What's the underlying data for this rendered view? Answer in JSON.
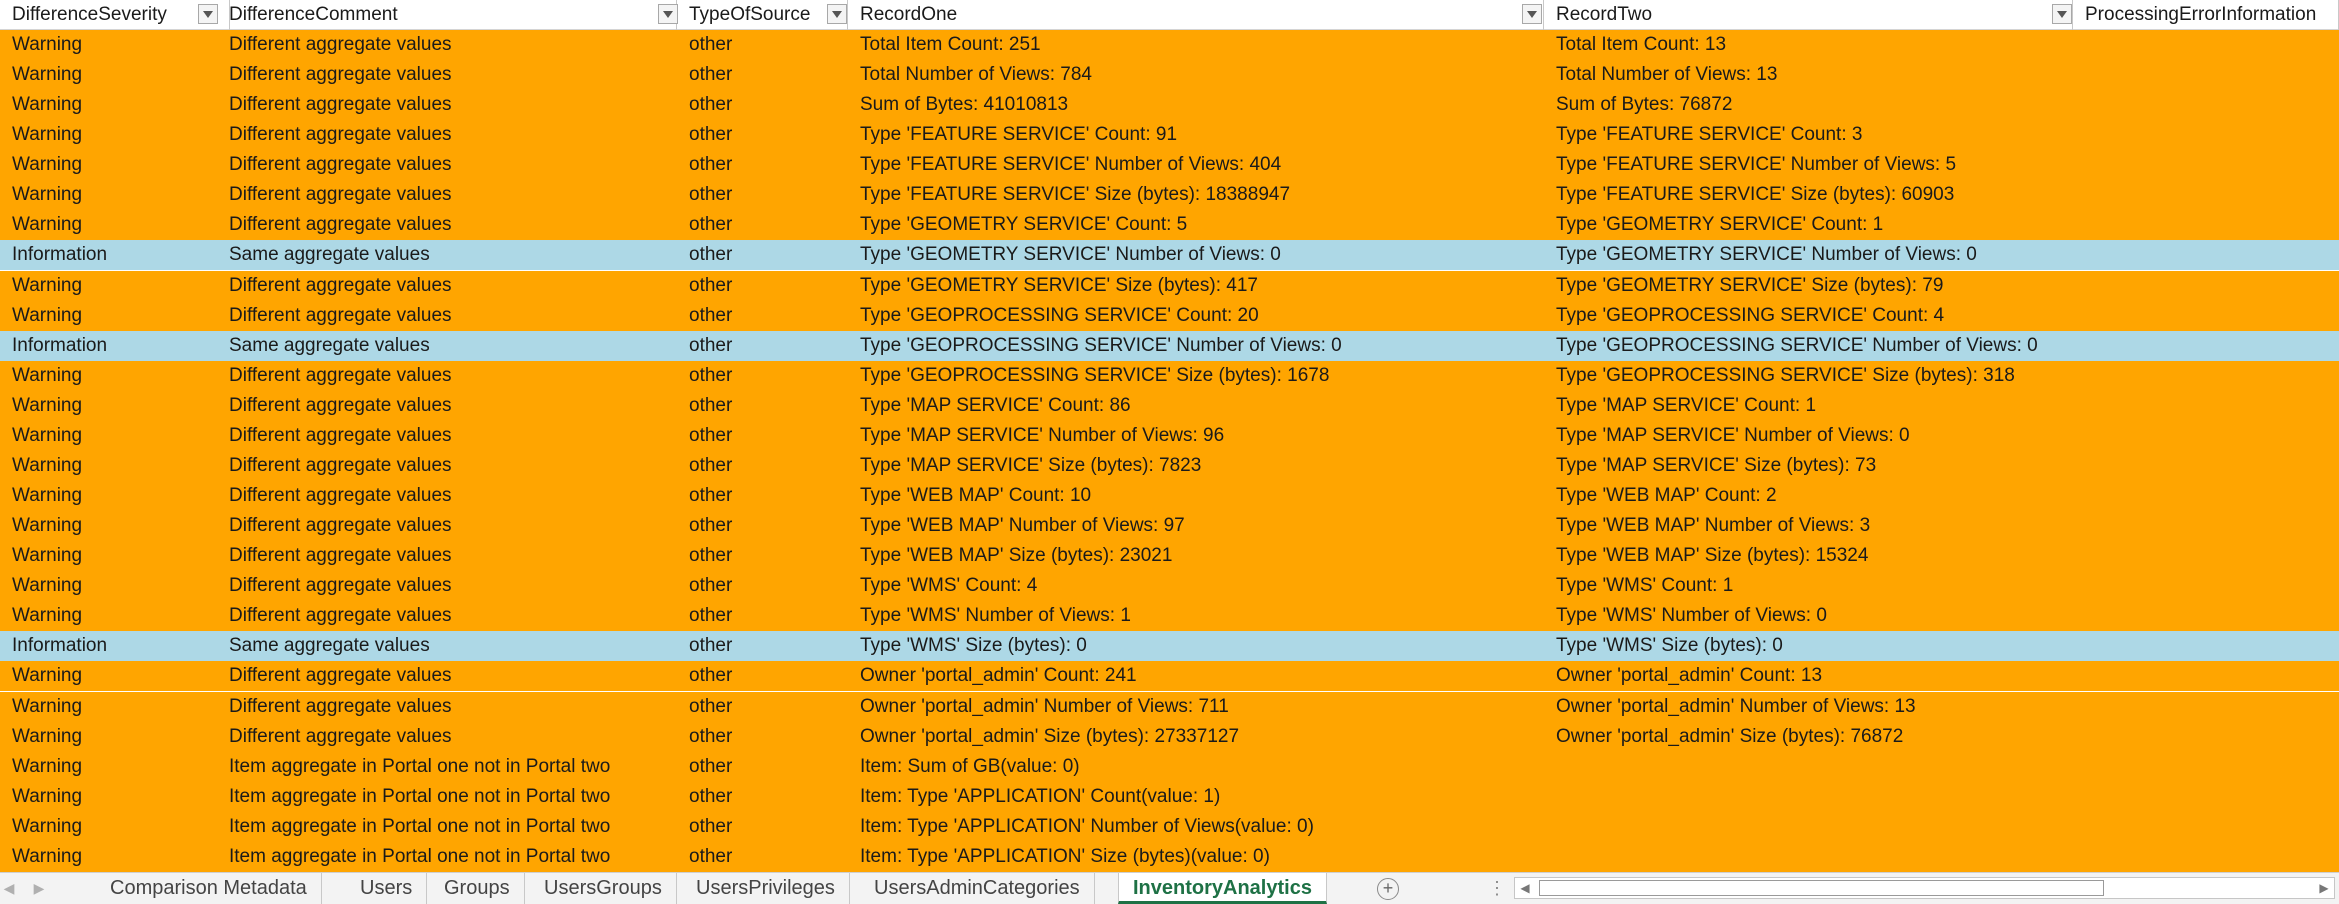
{
  "colors": {
    "warning_row": "#ffa500",
    "information_row": "#add8e6",
    "active_tab_text": "#1e7145"
  },
  "columns": [
    "DifferenceSeverity",
    "DifferenceComment",
    "TypeOfSource",
    "RecordOne",
    "RecordTwo",
    "ProcessingErrorInformation"
  ],
  "rows": [
    {
      "severity": "Warning",
      "comment": "Different aggregate values",
      "source": "other",
      "record_one": "Total Item Count: 251",
      "record_two": "Total Item Count: 13"
    },
    {
      "severity": "Warning",
      "comment": "Different aggregate values",
      "source": "other",
      "record_one": "Total Number of Views: 784",
      "record_two": "Total Number of Views: 13"
    },
    {
      "severity": "Warning",
      "comment": "Different aggregate values",
      "source": "other",
      "record_one": "Sum of Bytes: 41010813",
      "record_two": "Sum of Bytes: 76872"
    },
    {
      "severity": "Warning",
      "comment": "Different aggregate values",
      "source": "other",
      "record_one": "Type 'FEATURE SERVICE' Count: 91",
      "record_two": "Type 'FEATURE SERVICE' Count: 3"
    },
    {
      "severity": "Warning",
      "comment": "Different aggregate values",
      "source": "other",
      "record_one": "Type 'FEATURE SERVICE' Number of Views: 404",
      "record_two": "Type 'FEATURE SERVICE' Number of Views: 5"
    },
    {
      "severity": "Warning",
      "comment": "Different aggregate values",
      "source": "other",
      "record_one": "Type 'FEATURE SERVICE' Size (bytes): 18388947",
      "record_two": "Type 'FEATURE SERVICE' Size (bytes): 60903"
    },
    {
      "severity": "Warning",
      "comment": "Different aggregate values",
      "source": "other",
      "record_one": "Type 'GEOMETRY SERVICE' Count: 5",
      "record_two": "Type 'GEOMETRY SERVICE' Count: 1"
    },
    {
      "severity": "Information",
      "comment": "Same aggregate values",
      "source": "other",
      "record_one": "Type 'GEOMETRY SERVICE' Number of Views: 0",
      "record_two": "Type 'GEOMETRY SERVICE' Number of Views: 0"
    },
    {
      "severity": "Warning",
      "comment": "Different aggregate values",
      "source": "other",
      "record_one": "Type 'GEOMETRY SERVICE' Size (bytes): 417",
      "record_two": "Type 'GEOMETRY SERVICE' Size (bytes): 79"
    },
    {
      "severity": "Warning",
      "comment": "Different aggregate values",
      "source": "other",
      "record_one": "Type 'GEOPROCESSING SERVICE' Count: 20",
      "record_two": "Type 'GEOPROCESSING SERVICE' Count: 4"
    },
    {
      "severity": "Information",
      "comment": "Same aggregate values",
      "source": "other",
      "record_one": "Type 'GEOPROCESSING SERVICE' Number of Views: 0",
      "record_two": "Type 'GEOPROCESSING SERVICE' Number of Views: 0"
    },
    {
      "severity": "Warning",
      "comment": "Different aggregate values",
      "source": "other",
      "record_one": "Type 'GEOPROCESSING SERVICE' Size (bytes): 1678",
      "record_two": "Type 'GEOPROCESSING SERVICE' Size (bytes): 318"
    },
    {
      "severity": "Warning",
      "comment": "Different aggregate values",
      "source": "other",
      "record_one": "Type 'MAP SERVICE' Count: 86",
      "record_two": "Type 'MAP SERVICE' Count: 1"
    },
    {
      "severity": "Warning",
      "comment": "Different aggregate values",
      "source": "other",
      "record_one": "Type 'MAP SERVICE' Number of Views: 96",
      "record_two": "Type 'MAP SERVICE' Number of Views: 0"
    },
    {
      "severity": "Warning",
      "comment": "Different aggregate values",
      "source": "other",
      "record_one": "Type 'MAP SERVICE' Size (bytes): 7823",
      "record_two": "Type 'MAP SERVICE' Size (bytes): 73"
    },
    {
      "severity": "Warning",
      "comment": "Different aggregate values",
      "source": "other",
      "record_one": "Type 'WEB MAP' Count: 10",
      "record_two": "Type 'WEB MAP' Count: 2"
    },
    {
      "severity": "Warning",
      "comment": "Different aggregate values",
      "source": "other",
      "record_one": "Type 'WEB MAP' Number of Views: 97",
      "record_two": "Type 'WEB MAP' Number of Views: 3"
    },
    {
      "severity": "Warning",
      "comment": "Different aggregate values",
      "source": "other",
      "record_one": "Type 'WEB MAP' Size (bytes): 23021",
      "record_two": "Type 'WEB MAP' Size (bytes): 15324"
    },
    {
      "severity": "Warning",
      "comment": "Different aggregate values",
      "source": "other",
      "record_one": "Type 'WMS' Count: 4",
      "record_two": "Type 'WMS' Count: 1"
    },
    {
      "severity": "Warning",
      "comment": "Different aggregate values",
      "source": "other",
      "record_one": "Type 'WMS' Number of Views: 1",
      "record_two": "Type 'WMS' Number of Views: 0"
    },
    {
      "severity": "Information",
      "comment": "Same aggregate values",
      "source": "other",
      "record_one": "Type 'WMS' Size (bytes): 0",
      "record_two": "Type 'WMS' Size (bytes): 0"
    },
    {
      "severity": "Warning",
      "comment": "Different aggregate values",
      "source": "other",
      "record_one": "Owner 'portal_admin' Count: 241",
      "record_two": "Owner 'portal_admin' Count: 13"
    },
    {
      "severity": "Warning",
      "comment": "Different aggregate values",
      "source": "other",
      "record_one": "Owner 'portal_admin' Number of Views: 711",
      "record_two": "Owner 'portal_admin' Number of Views: 13"
    },
    {
      "severity": "Warning",
      "comment": "Different aggregate values",
      "source": "other",
      "record_one": "Owner 'portal_admin' Size (bytes): 27337127",
      "record_two": "Owner 'portal_admin' Size (bytes): 76872"
    },
    {
      "severity": "Warning",
      "comment": "Item aggregate in Portal one not in Portal two",
      "source": "other",
      "record_one": "Item: Sum of GB(value: 0)",
      "record_two": ""
    },
    {
      "severity": "Warning",
      "comment": "Item aggregate in Portal one not in Portal two",
      "source": "other",
      "record_one": "Item: Type 'APPLICATION' Count(value: 1)",
      "record_two": ""
    },
    {
      "severity": "Warning",
      "comment": "Item aggregate in Portal one not in Portal two",
      "source": "other",
      "record_one": "Item: Type 'APPLICATION' Number of Views(value: 0)",
      "record_two": ""
    },
    {
      "severity": "Warning",
      "comment": "Item aggregate in Portal one not in Portal two",
      "source": "other",
      "record_one": "Item: Type 'APPLICATION' Size (bytes)(value: 0)",
      "record_two": ""
    }
  ],
  "tabs": [
    {
      "label": "Comparison Metadata",
      "active": false
    },
    {
      "label": "Users",
      "active": false
    },
    {
      "label": "Groups",
      "active": false
    },
    {
      "label": "UsersGroups",
      "active": false
    },
    {
      "label": "UsersPrivileges",
      "active": false
    },
    {
      "label": "UsersAdminCategories",
      "active": false
    },
    {
      "label": "InventoryAnalytics",
      "active": true
    }
  ],
  "tabbar": {
    "add_sheet_symbol": "+",
    "more_symbol": "⋮"
  }
}
